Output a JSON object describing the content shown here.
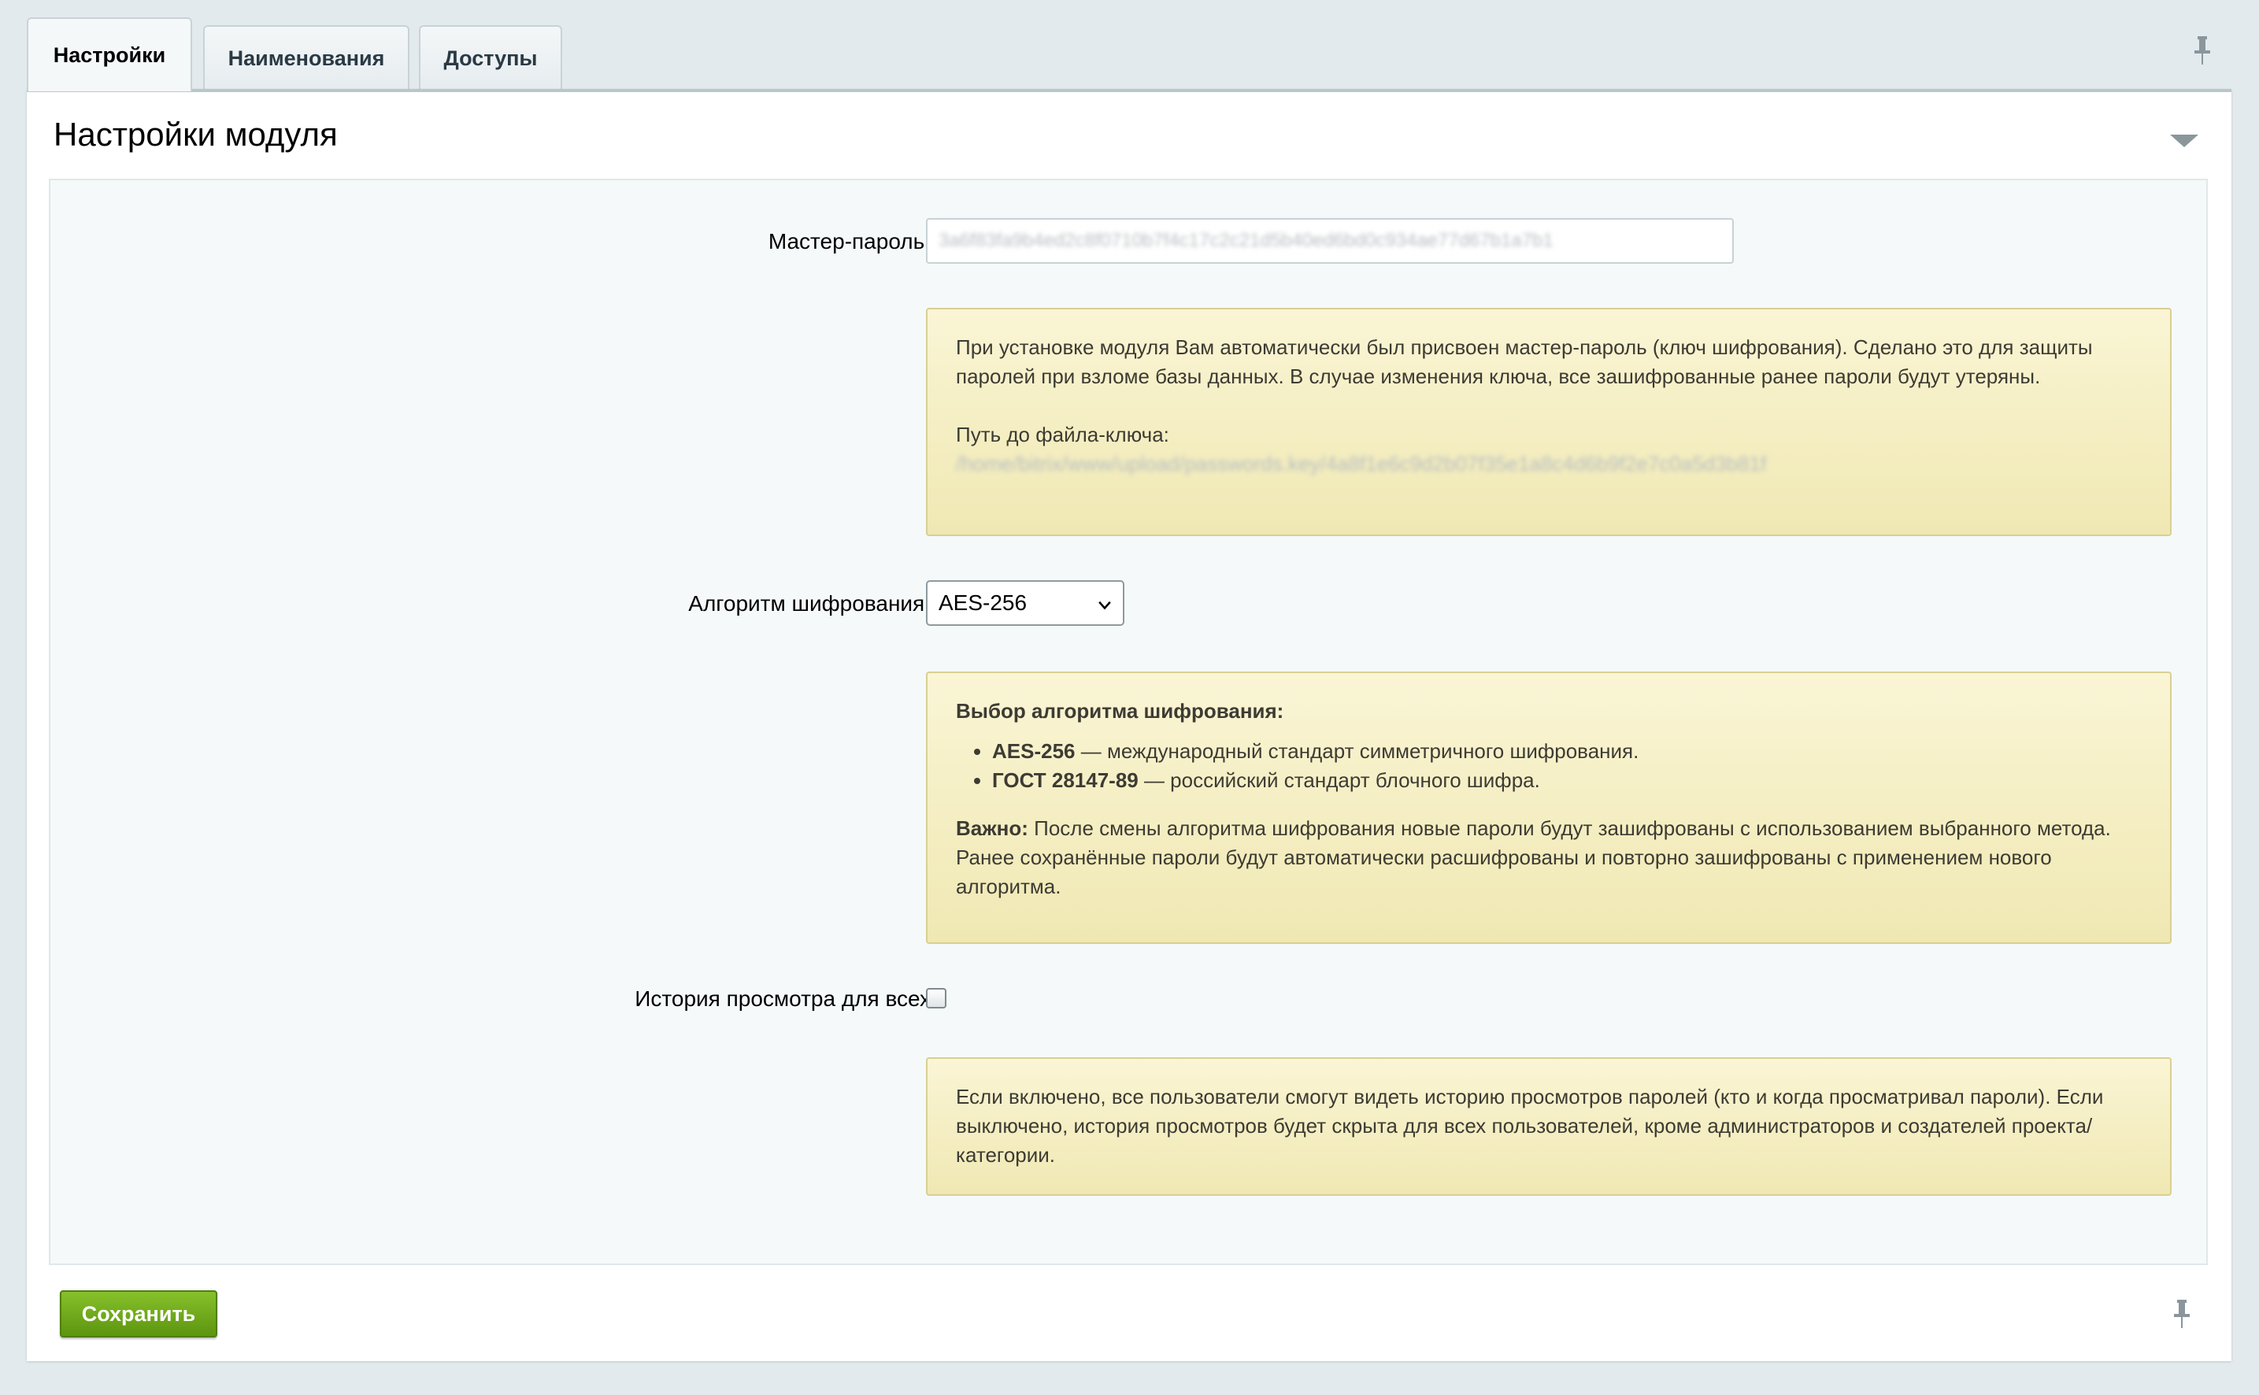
{
  "tabs": [
    {
      "label": "Настройки",
      "active": true
    },
    {
      "label": "Наименования",
      "active": false
    },
    {
      "label": "Доступы",
      "active": false
    }
  ],
  "section": {
    "title": "Настройки модуля"
  },
  "master_password": {
    "label": "Мастер-пароль:",
    "value": "3a6f83fa9b4ed2c8f0710b7f4c17c2c21d5b40ed6bd0c934ae77d67b1a7b1"
  },
  "master_note": {
    "text": "При установке модуля Вам автоматически был присвоен мастер-пароль (ключ шифрования). Сделано это для защиты паролей при взломе базы данных. В случае изменения ключа, все зашифрованные ранее пароли будут утеряны.",
    "key_path_label": "Путь до файла-ключа:",
    "key_path_value": "/home/bitrix/www/upload/passwords.key/4a8f1e6c9d2b07f35e1a8c4d6b9f2e7c0a5d3b81f"
  },
  "algorithm": {
    "label": "Алгоритм шифрования:",
    "selected": "AES-256",
    "icon": "chevron-down-icon"
  },
  "algorithm_note": {
    "heading": "Выбор алгоритма шифрования:",
    "items": [
      {
        "name": "AES-256",
        "desc": " — международный стандарт симметричного шифрования."
      },
      {
        "name": "ГОСТ 28147-89",
        "desc": " — российский стандарт блочного шифра."
      }
    ],
    "important_label": "Важно:",
    "important_text": " После смены алгоритма шифрования новые пароли будут зашифрованы с использованием выбранного метода. Ранее сохранённые пароли будут автоматически расшифрованы и повторно зашифрованы с применением нового алгоритма."
  },
  "history": {
    "label": "История просмотра для всех",
    "checked": false
  },
  "history_note": {
    "text": "Если включено, все пользователи смогут видеть историю просмотров паролей (кто и когда просматривал пароли). Если выключено, история просмотров будет скрыта для всех пользователей, кроме администраторов и создателей проекта/категории."
  },
  "footer": {
    "save_label": "Сохранить"
  },
  "colors": {
    "save_button": "#6fa81d",
    "note_bg": "#f7f1c8",
    "page_bg": "#e3eaed"
  }
}
